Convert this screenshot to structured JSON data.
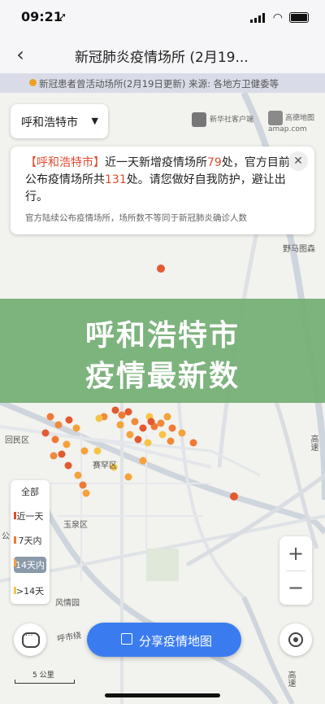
{
  "status_bar": {
    "time": "09:21",
    "location_arrow": "➚"
  },
  "nav": {
    "back_icon": "‹",
    "title": "新冠肺炎疫情场所 (2月19..."
  },
  "banner": {
    "text": "新冠患者曾活动场所(2月19日更新) 来源: 各地方卫健委等"
  },
  "city_selector": {
    "label": "呼和浩特市"
  },
  "logos": {
    "xinhua": "新华社客户端",
    "amap": "高德地图 amap.com"
  },
  "alert": {
    "prefix": "【呼和浩特市】",
    "part1": "近一天新增疫情场所",
    "new_count": "79",
    "part2": "处，官方目前公布疫情场所共",
    "total_count": "131",
    "part3": "处。请您做好自我防护，避让出行。",
    "note": "官方陆续公布疫情场所，场所数不等同于新冠肺炎确诊人数",
    "close_icon": "✕"
  },
  "overlay": {
    "line1": "呼和浩特市",
    "line2": "疫情最新数"
  },
  "map_labels": {
    "yema": "野马图森",
    "huimin": "回民区",
    "saihan": "赛罕区",
    "yuquan": "玉泉区",
    "fengqing": "风情园",
    "gong": "公",
    "hushi": "呼市绕",
    "gaosu1": "高速",
    "gaosu2": "高速"
  },
  "legend": {
    "items": [
      {
        "label": "全部",
        "color": ""
      },
      {
        "label": "近一天",
        "color": "#e04a2f"
      },
      {
        "label": "7天内",
        "color": "#ef7a35"
      },
      {
        "label": "14天内",
        "color": "#f4a23a"
      },
      {
        "label": ">14天",
        "color": "#f6c445"
      }
    ]
  },
  "zoom": {
    "in": "+",
    "out": "−"
  },
  "share": {
    "label": "分享疫情地图"
  },
  "scale": {
    "label": "5 公里"
  },
  "colors": {
    "accent": "#3a7cf0",
    "alert_red": "#e04a2f",
    "overlay_green": "#78b078"
  }
}
